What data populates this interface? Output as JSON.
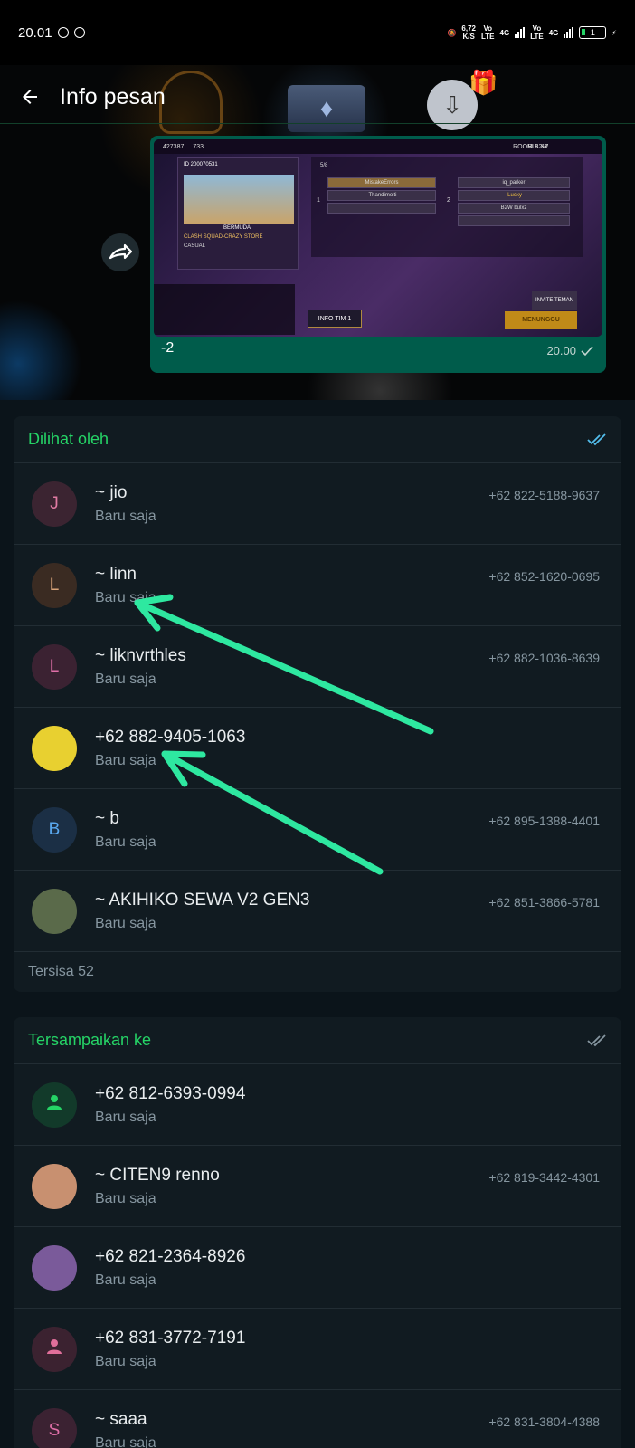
{
  "status_bar": {
    "time": "20.01",
    "speed": "6,72",
    "speed_unit": "K/S",
    "net1": "Vo",
    "net1b": "LTE",
    "net2": "4G",
    "net3": "Vo",
    "net3b": "LTE",
    "net4": "4G",
    "battery": "1"
  },
  "header": {
    "title": "Info pesan"
  },
  "message": {
    "caption": "-2",
    "time": "20.00",
    "image_texts": {
      "id": "ID 200070531",
      "coins": "427387",
      "gems": "733",
      "room": "ROOM B2W",
      "room2": "BULXZ",
      "map": "BERMUDA",
      "mode": "CLASH SQUAD-CRAZY STORE",
      "casual": "CASUAL",
      "slots_left": [
        "MistakeErrors",
        "-Thandimolti"
      ],
      "slots_right": [
        "iq_parker",
        "-Lucky",
        "B2W  bulxz"
      ],
      "team_a": "1",
      "team_b": "2",
      "count": "5/8",
      "invite": "INVITE TEMAN",
      "info_tim": "INFO TIM 1",
      "wait": "MENUNGGU"
    }
  },
  "seen": {
    "title": "Dilihat oleh",
    "rows": [
      {
        "initial": "J",
        "name": "~ jio",
        "sub": "Baru saja",
        "phone": "+62 822-5188-9637",
        "color": "#e07ba3",
        "bg": "#3b2431"
      },
      {
        "initial": "L",
        "name": "~ linn",
        "sub": "Baru saja",
        "phone": "+62 852-1620-0695",
        "color": "#d9a57a",
        "bg": "#3a2b22"
      },
      {
        "initial": "L",
        "name": "~ liknvrthles",
        "sub": "Baru saja",
        "phone": "+62 882-1036-8639",
        "color": "#e06fa8",
        "bg": "#3b2232"
      },
      {
        "initial": "",
        "name": "+62 882-9405-1063",
        "sub": "Baru saja",
        "phone": "",
        "color": "#000000",
        "bg": "#e8d030"
      },
      {
        "initial": "B",
        "name": "~ b",
        "sub": "Baru saja",
        "phone": "+62 895-1388-4401",
        "color": "#5aa9f0",
        "bg": "#1b2f45"
      },
      {
        "initial": "",
        "name": "~ AKIHIKO SEWA V2 GEN3",
        "sub": "Baru saja",
        "phone": "+62 851-3866-5781",
        "color": "#ffffff",
        "bg": "#5a6a4a"
      }
    ],
    "more": "Tersisa 52"
  },
  "delivered": {
    "title": "Tersampaikan ke",
    "rows": [
      {
        "initial": "",
        "name": "+62 812-6393-0994",
        "sub": "Baru saja",
        "phone": "",
        "color": "#25d366",
        "bg": "#123a2a",
        "icon": "person-icon"
      },
      {
        "initial": "",
        "name": "~ CITEN9 renno",
        "sub": "Baru saja",
        "phone": "+62 819-3442-4301",
        "color": "#fff",
        "bg": "#c89070"
      },
      {
        "initial": "",
        "name": "+62 821-2364-8926",
        "sub": "Baru saja",
        "phone": "",
        "color": "#fff",
        "bg": "#7a5a9a"
      },
      {
        "initial": "",
        "name": "+62 831-3772-7191",
        "sub": "Baru saja",
        "phone": "",
        "color": "#e06f9a",
        "bg": "#3b2230",
        "icon": "person-icon"
      },
      {
        "initial": "S",
        "name": "~ saaa",
        "sub": "Baru saja",
        "phone": "+62 831-3804-4388",
        "color": "#e06fa8",
        "bg": "#3b2232"
      }
    ]
  },
  "colors": {
    "accent": "#25d366",
    "bg": "#0b141a",
    "panel": "#111b21",
    "bubble": "#005c4b",
    "read_tick": "#53bdeb",
    "arrow": "#2ee8a0"
  }
}
